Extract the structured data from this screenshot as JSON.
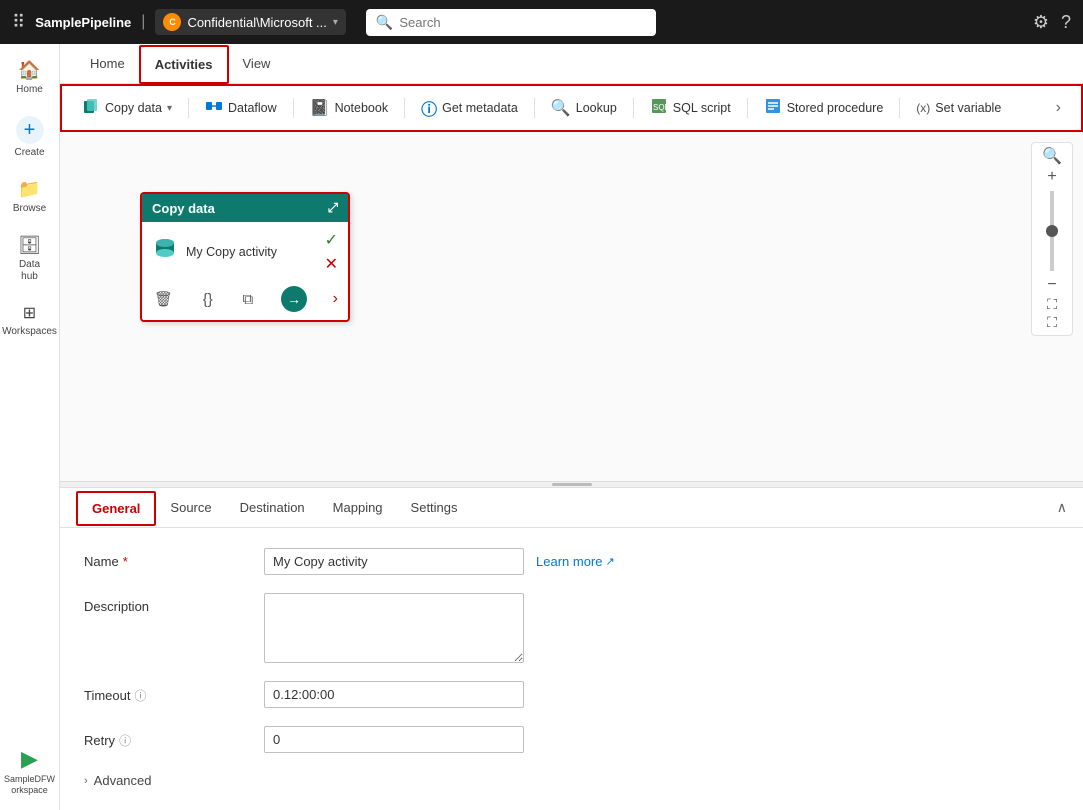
{
  "topbar": {
    "dots_icon": "⠿",
    "title": "SamplePipeline",
    "divider": "|",
    "workspace_icon": "C",
    "workspace_label": "Confidential\\Microsoft ...",
    "chevron": "▾",
    "search_placeholder": "Search",
    "settings_icon": "⚙",
    "help_icon": "?"
  },
  "sidebar": {
    "items": [
      {
        "id": "home",
        "icon": "🏠",
        "label": "Home"
      },
      {
        "id": "create",
        "icon": "+",
        "label": "Create"
      },
      {
        "id": "browse",
        "icon": "📁",
        "label": "Browse"
      },
      {
        "id": "datahub",
        "icon": "🗄",
        "label": "Data hub"
      },
      {
        "id": "workspaces",
        "icon": "⊞",
        "label": "Workspaces"
      }
    ],
    "bottom": {
      "icon": "▶",
      "label": "SampleDFWorkspace"
    }
  },
  "tabs": {
    "items": [
      {
        "id": "home",
        "label": "Home",
        "active": false
      },
      {
        "id": "activities",
        "label": "Activities",
        "active": true,
        "highlighted": true
      },
      {
        "id": "view",
        "label": "View",
        "active": false
      }
    ]
  },
  "activities_toolbar": {
    "items": [
      {
        "id": "copy-data",
        "icon": "📋",
        "label": "Copy data",
        "has_chevron": true
      },
      {
        "id": "dataflow",
        "icon": "⟦⟧",
        "label": "Dataflow",
        "has_chevron": false
      },
      {
        "id": "notebook",
        "icon": "📓",
        "label": "Notebook",
        "has_chevron": false
      },
      {
        "id": "get-metadata",
        "icon": "ℹ",
        "label": "Get metadata",
        "has_chevron": false
      },
      {
        "id": "lookup",
        "icon": "🔍",
        "label": "Lookup",
        "has_chevron": false
      },
      {
        "id": "sql-script",
        "icon": "📄",
        "label": "SQL script",
        "has_chevron": false
      },
      {
        "id": "stored-procedure",
        "icon": "☰",
        "label": "Stored procedure",
        "has_chevron": false
      },
      {
        "id": "set-variable",
        "icon": "(x)",
        "label": "Set variable",
        "has_chevron": false
      }
    ],
    "more_icon": "›"
  },
  "copy_card": {
    "header": "Copy data",
    "name": "My Copy activity",
    "check_icon": "✓",
    "x_icon": "✕",
    "nav_icon": "›",
    "actions": {
      "delete_icon": "🗑",
      "code_icon": "{}",
      "copy_icon": "⧉",
      "go_icon": "→"
    }
  },
  "zoom": {
    "plus": "+",
    "minus": "−",
    "value": 50,
    "expand_icon": "⛶",
    "fullscreen_icon": "⛶"
  },
  "bottom_tabs": [
    {
      "id": "general",
      "label": "General",
      "active": true,
      "highlighted": true
    },
    {
      "id": "source",
      "label": "Source",
      "active": false
    },
    {
      "id": "destination",
      "label": "Destination",
      "active": false
    },
    {
      "id": "mapping",
      "label": "Mapping",
      "active": false
    },
    {
      "id": "settings",
      "label": "Settings",
      "active": false
    }
  ],
  "form": {
    "name_label": "Name",
    "name_required": "*",
    "name_value": "My Copy activity",
    "learn_more_label": "Learn more",
    "learn_more_icon": "↗",
    "description_label": "Description",
    "description_value": "",
    "timeout_label": "Timeout",
    "timeout_info": "ⓘ",
    "timeout_value": "0.12:00:00",
    "retry_label": "Retry",
    "retry_info": "ⓘ",
    "retry_value": "0",
    "advanced_label": "Advanced",
    "advanced_chevron": "›"
  },
  "colors": {
    "accent": "#0078d4",
    "highlight": "#c00000",
    "card_header": "#0e7a6e",
    "active_tab": "#0078d4"
  }
}
